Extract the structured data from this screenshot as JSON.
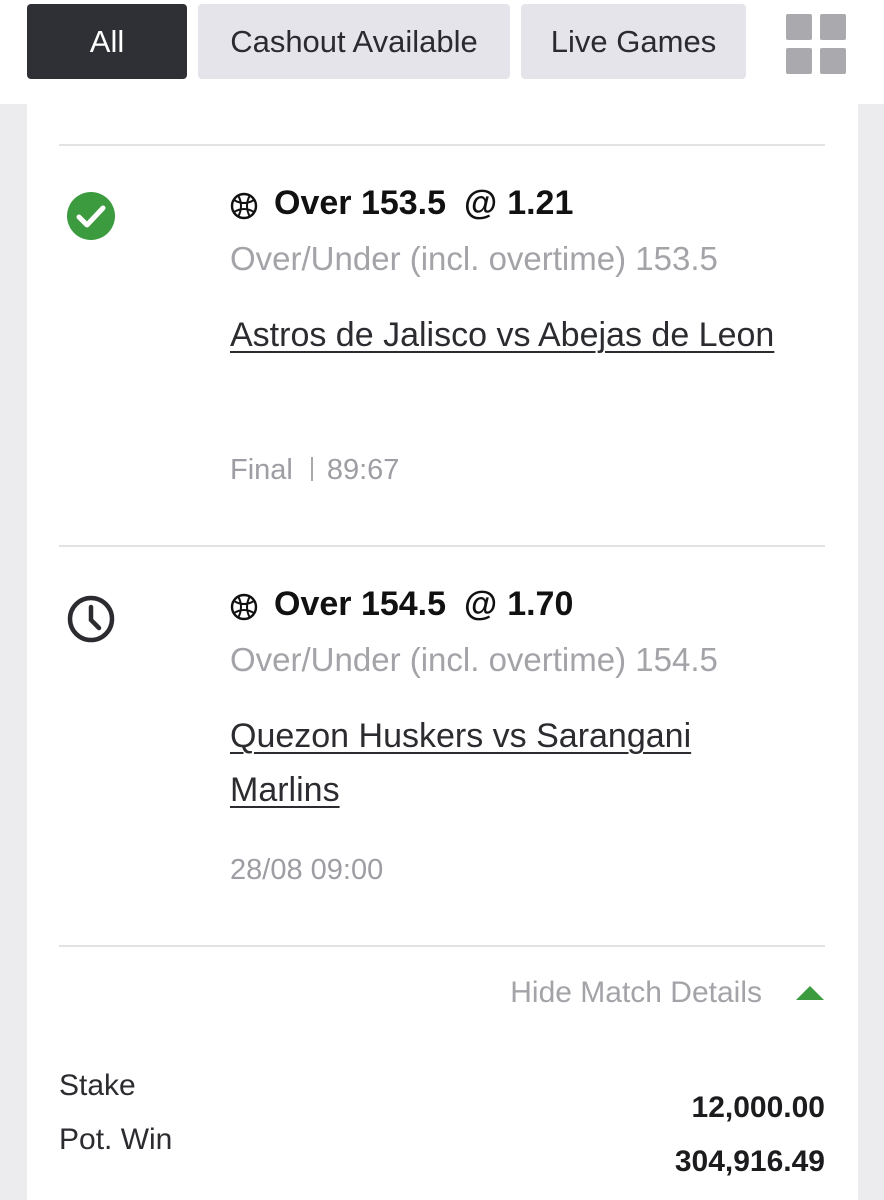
{
  "tabs": {
    "all": "All",
    "cashout": "Cashout Available",
    "live": "Live Games"
  },
  "colors": {
    "active_tab": "#2f3035",
    "settled_green": "#3c9a3f",
    "muted_text": "#a3a3a8"
  },
  "selections": [
    {
      "status_icon": "check-circle-icon",
      "sport_icon": "basketball-icon",
      "pick": "Over 153.5",
      "at": "@",
      "odds": "1.21",
      "market": "Over/Under (incl. overtime) 153.5",
      "match": "Astros de Jalisco vs Abejas de Leon",
      "status": "Final",
      "score": "89:67"
    },
    {
      "status_icon": "clock-icon",
      "sport_icon": "basketball-icon",
      "pick": "Over 154.5",
      "at": "@",
      "odds": "1.70",
      "market": "Over/Under (incl. overtime) 154.5",
      "match": "Quezon Huskers vs Sarangani Marlins",
      "datetime": "28/08 09:00"
    }
  ],
  "details_toggle": "Hide Match Details",
  "summary": {
    "stake_label": "Stake",
    "stake_value": "12,000.00",
    "potwin_label": "Pot. Win",
    "potwin_value": "304,916.49"
  }
}
